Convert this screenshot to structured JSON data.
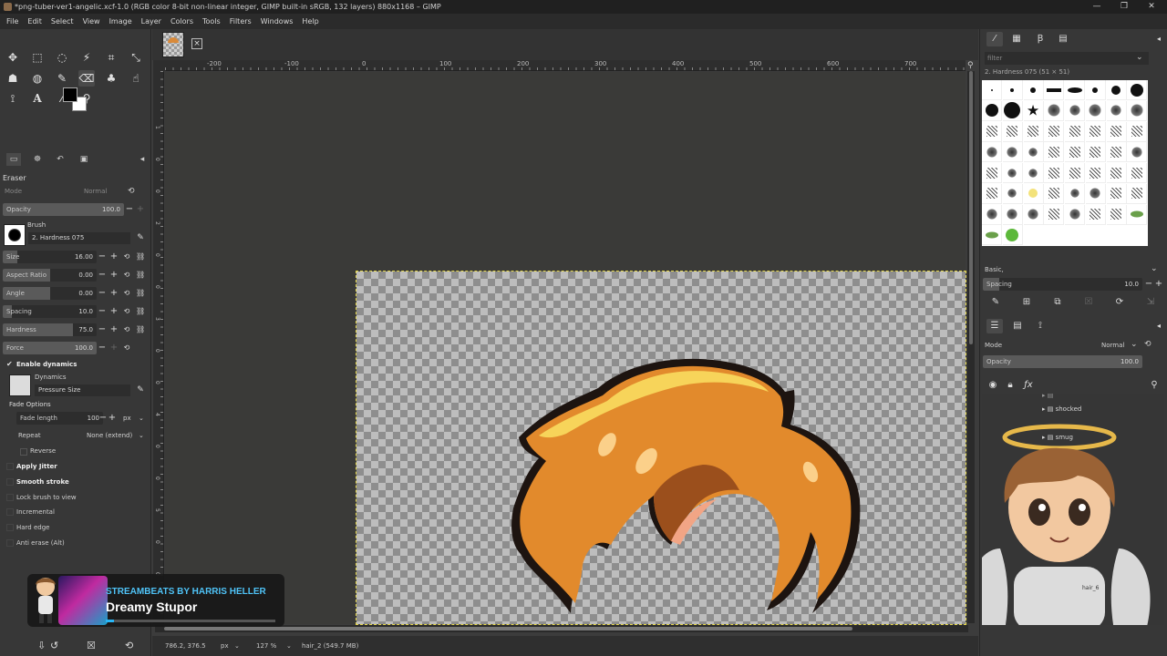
{
  "window": {
    "title": "*png-tuber-ver1-angelic.xcf-1.0 (RGB color 8-bit non-linear integer, GIMP built-in sRGB, 132 layers) 880x1168 – GIMP",
    "controls": [
      "—",
      "❐",
      "✕"
    ]
  },
  "menu": [
    "File",
    "Edit",
    "Select",
    "View",
    "Image",
    "Layer",
    "Colors",
    "Tools",
    "Filters",
    "Windows",
    "Help"
  ],
  "tool_options": {
    "title": "Eraser",
    "mode_label": "Mode",
    "mode_value": "Normal",
    "opacity": {
      "label": "Opacity",
      "value": "100.0",
      "fraction": 1.0
    },
    "brush_label": "Brush",
    "brush_name": "2. Hardness 075",
    "size": {
      "label": "Size",
      "value": "16.00",
      "fraction": 0.16
    },
    "aspect_ratio": {
      "label": "Aspect Ratio",
      "value": "0.00",
      "fraction": 0.5
    },
    "angle": {
      "label": "Angle",
      "value": "0.00",
      "fraction": 0.5
    },
    "spacing": {
      "label": "Spacing",
      "value": "10.0",
      "fraction": 0.1
    },
    "hardness": {
      "label": "Hardness",
      "value": "75.0",
      "fraction": 0.75
    },
    "force": {
      "label": "Force",
      "value": "100.0",
      "fraction": 1.0
    },
    "enable_dynamics": "Enable dynamics",
    "dynamics_label": "Dynamics",
    "dynamics_value": "Pressure Size",
    "fade_options": "Fade Options",
    "fade_length_label": "Fade length",
    "fade_length_value": "100",
    "fade_unit": "px",
    "repeat_label": "Repeat",
    "repeat_value": "None (extend)",
    "reverse": "Reverse",
    "apply_jitter": "Apply Jitter",
    "smooth_stroke": "Smooth stroke",
    "lock_brush": "Lock brush to view",
    "incremental": "Incremental",
    "hard_edge": "Hard edge",
    "anti_erase": "Anti erase (Alt)"
  },
  "ruler": {
    "h_ticks": [
      "-200",
      "-100",
      "0",
      "100",
      "200",
      "300",
      "400",
      "500",
      "600",
      "700"
    ],
    "v_ticks": [
      "1",
      "0",
      "0",
      "2",
      "0",
      "0",
      "3",
      "0",
      "0",
      "4",
      "0",
      "0",
      "5",
      "0",
      "0"
    ]
  },
  "overlay": {
    "line1": "STREAMBEATS BY HARRIS HELLER",
    "line2": "Dreamy Stupor",
    "progress": 0.05
  },
  "statusbar": {
    "coords": "786.2, 376.5",
    "unit": "px",
    "zoom": "127 %",
    "layer": "hair_2 (549.7 MB)"
  },
  "dock": {
    "filter_placeholder": "filter",
    "brush_title": "2. Hardness 075 (51 × 51)",
    "preset_label": "Basic,",
    "spacing_label": "Spacing",
    "spacing_value": "10.0",
    "mode_label": "Mode",
    "mode_value": "Normal",
    "opacity_label": "Opacity",
    "opacity_value": "100.0",
    "layers": [
      {
        "name": "shocked"
      },
      {
        "name": "smug"
      },
      {
        "name": "hair_6"
      }
    ]
  },
  "colors": {
    "accent": "#29b6f6",
    "hair": "#e48a2e",
    "hair_highlight": "#f6d15a",
    "selection": "#e6d84a"
  }
}
